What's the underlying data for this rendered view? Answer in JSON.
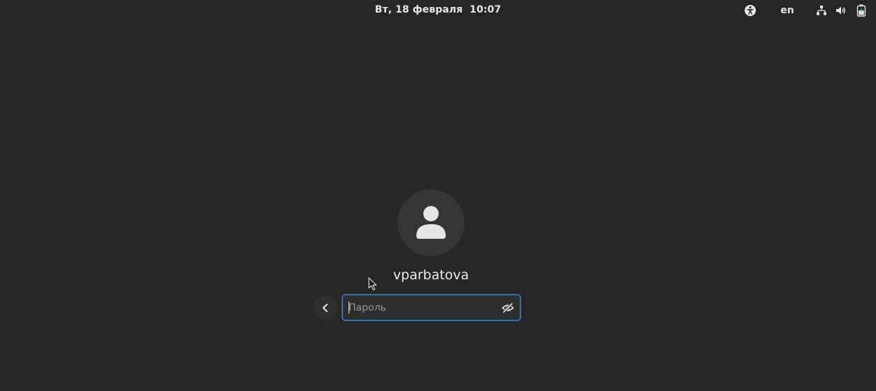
{
  "top_bar": {
    "clock": "Вт, 18 февраля  10:07",
    "keyboard_layout": "en",
    "icons": [
      "accessibility-icon",
      "network-icon",
      "volume-icon",
      "battery-icon"
    ]
  },
  "login": {
    "username": "vparbatova",
    "avatar_icon": "user-silhouette-icon",
    "password_placeholder": "Пароль",
    "password_value": "",
    "back_icon": "chevron-left-icon",
    "reveal_icon": "eye-slash-icon"
  },
  "colors": {
    "background": "#262626",
    "avatar_bg": "#353535",
    "focus_border": "#3a6eb8",
    "text": "#e8e8e8"
  }
}
